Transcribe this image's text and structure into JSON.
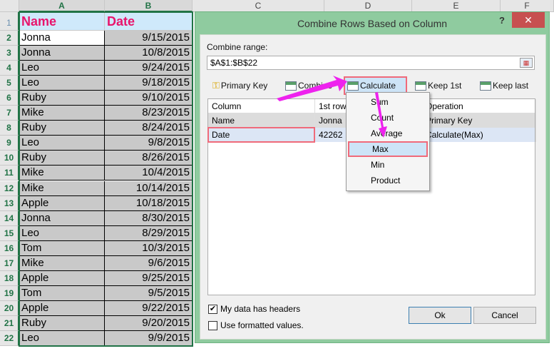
{
  "sheet": {
    "columns": [
      "A",
      "B",
      "C",
      "D",
      "E",
      "F"
    ],
    "header": {
      "name": "Name",
      "date": "Date"
    },
    "rows": [
      [
        "Jonna",
        "9/15/2015"
      ],
      [
        "Jonna",
        "10/8/2015"
      ],
      [
        "Leo",
        "9/24/2015"
      ],
      [
        "Leo",
        "9/18/2015"
      ],
      [
        "Ruby",
        "9/10/2015"
      ],
      [
        "Mike",
        "8/23/2015"
      ],
      [
        "Ruby",
        "8/24/2015"
      ],
      [
        "Leo",
        "9/8/2015"
      ],
      [
        "Ruby",
        "8/26/2015"
      ],
      [
        "Mike",
        "10/4/2015"
      ],
      [
        "Mike",
        "10/14/2015"
      ],
      [
        "Apple",
        "10/18/2015"
      ],
      [
        "Jonna",
        "8/30/2015"
      ],
      [
        "Leo",
        "8/29/2015"
      ],
      [
        "Tom",
        "10/3/2015"
      ],
      [
        "Mike",
        "9/6/2015"
      ],
      [
        "Apple",
        "9/25/2015"
      ],
      [
        "Tom",
        "9/5/2015"
      ],
      [
        "Apple",
        "9/22/2015"
      ],
      [
        "Ruby",
        "9/20/2015"
      ],
      [
        "Leo",
        "9/9/2015"
      ]
    ]
  },
  "dialog": {
    "title": "Combine Rows Based on Column",
    "help": "?",
    "close": "✕",
    "combine_range_label": "Combine range:",
    "combine_range_value": "$A$1:$B$22",
    "toolbar": {
      "primary_key": "Primary Key",
      "combine": "Combine",
      "calculate": "Calculate",
      "keep_first": "Keep 1st",
      "keep_last": "Keep last"
    },
    "table": {
      "headers": [
        "Column",
        "1st row",
        "Operation"
      ],
      "rows": [
        [
          "Name",
          "Jonna",
          "Primary Key"
        ],
        [
          "Date",
          "42262",
          "Calculate(Max)"
        ]
      ]
    },
    "menu": [
      "Sum",
      "Count",
      "Average",
      "Max",
      "Min",
      "Product"
    ],
    "has_headers_label": "My data has headers",
    "has_headers_checked": true,
    "formatted_label": "Use formatted values.",
    "formatted_checked": false,
    "ok": "Ok",
    "cancel": "Cancel"
  },
  "colors": {
    "accent": "#217346",
    "highlight": "#f06a7a",
    "arrow": "#ee22ee",
    "header_text": "#e8156c"
  }
}
